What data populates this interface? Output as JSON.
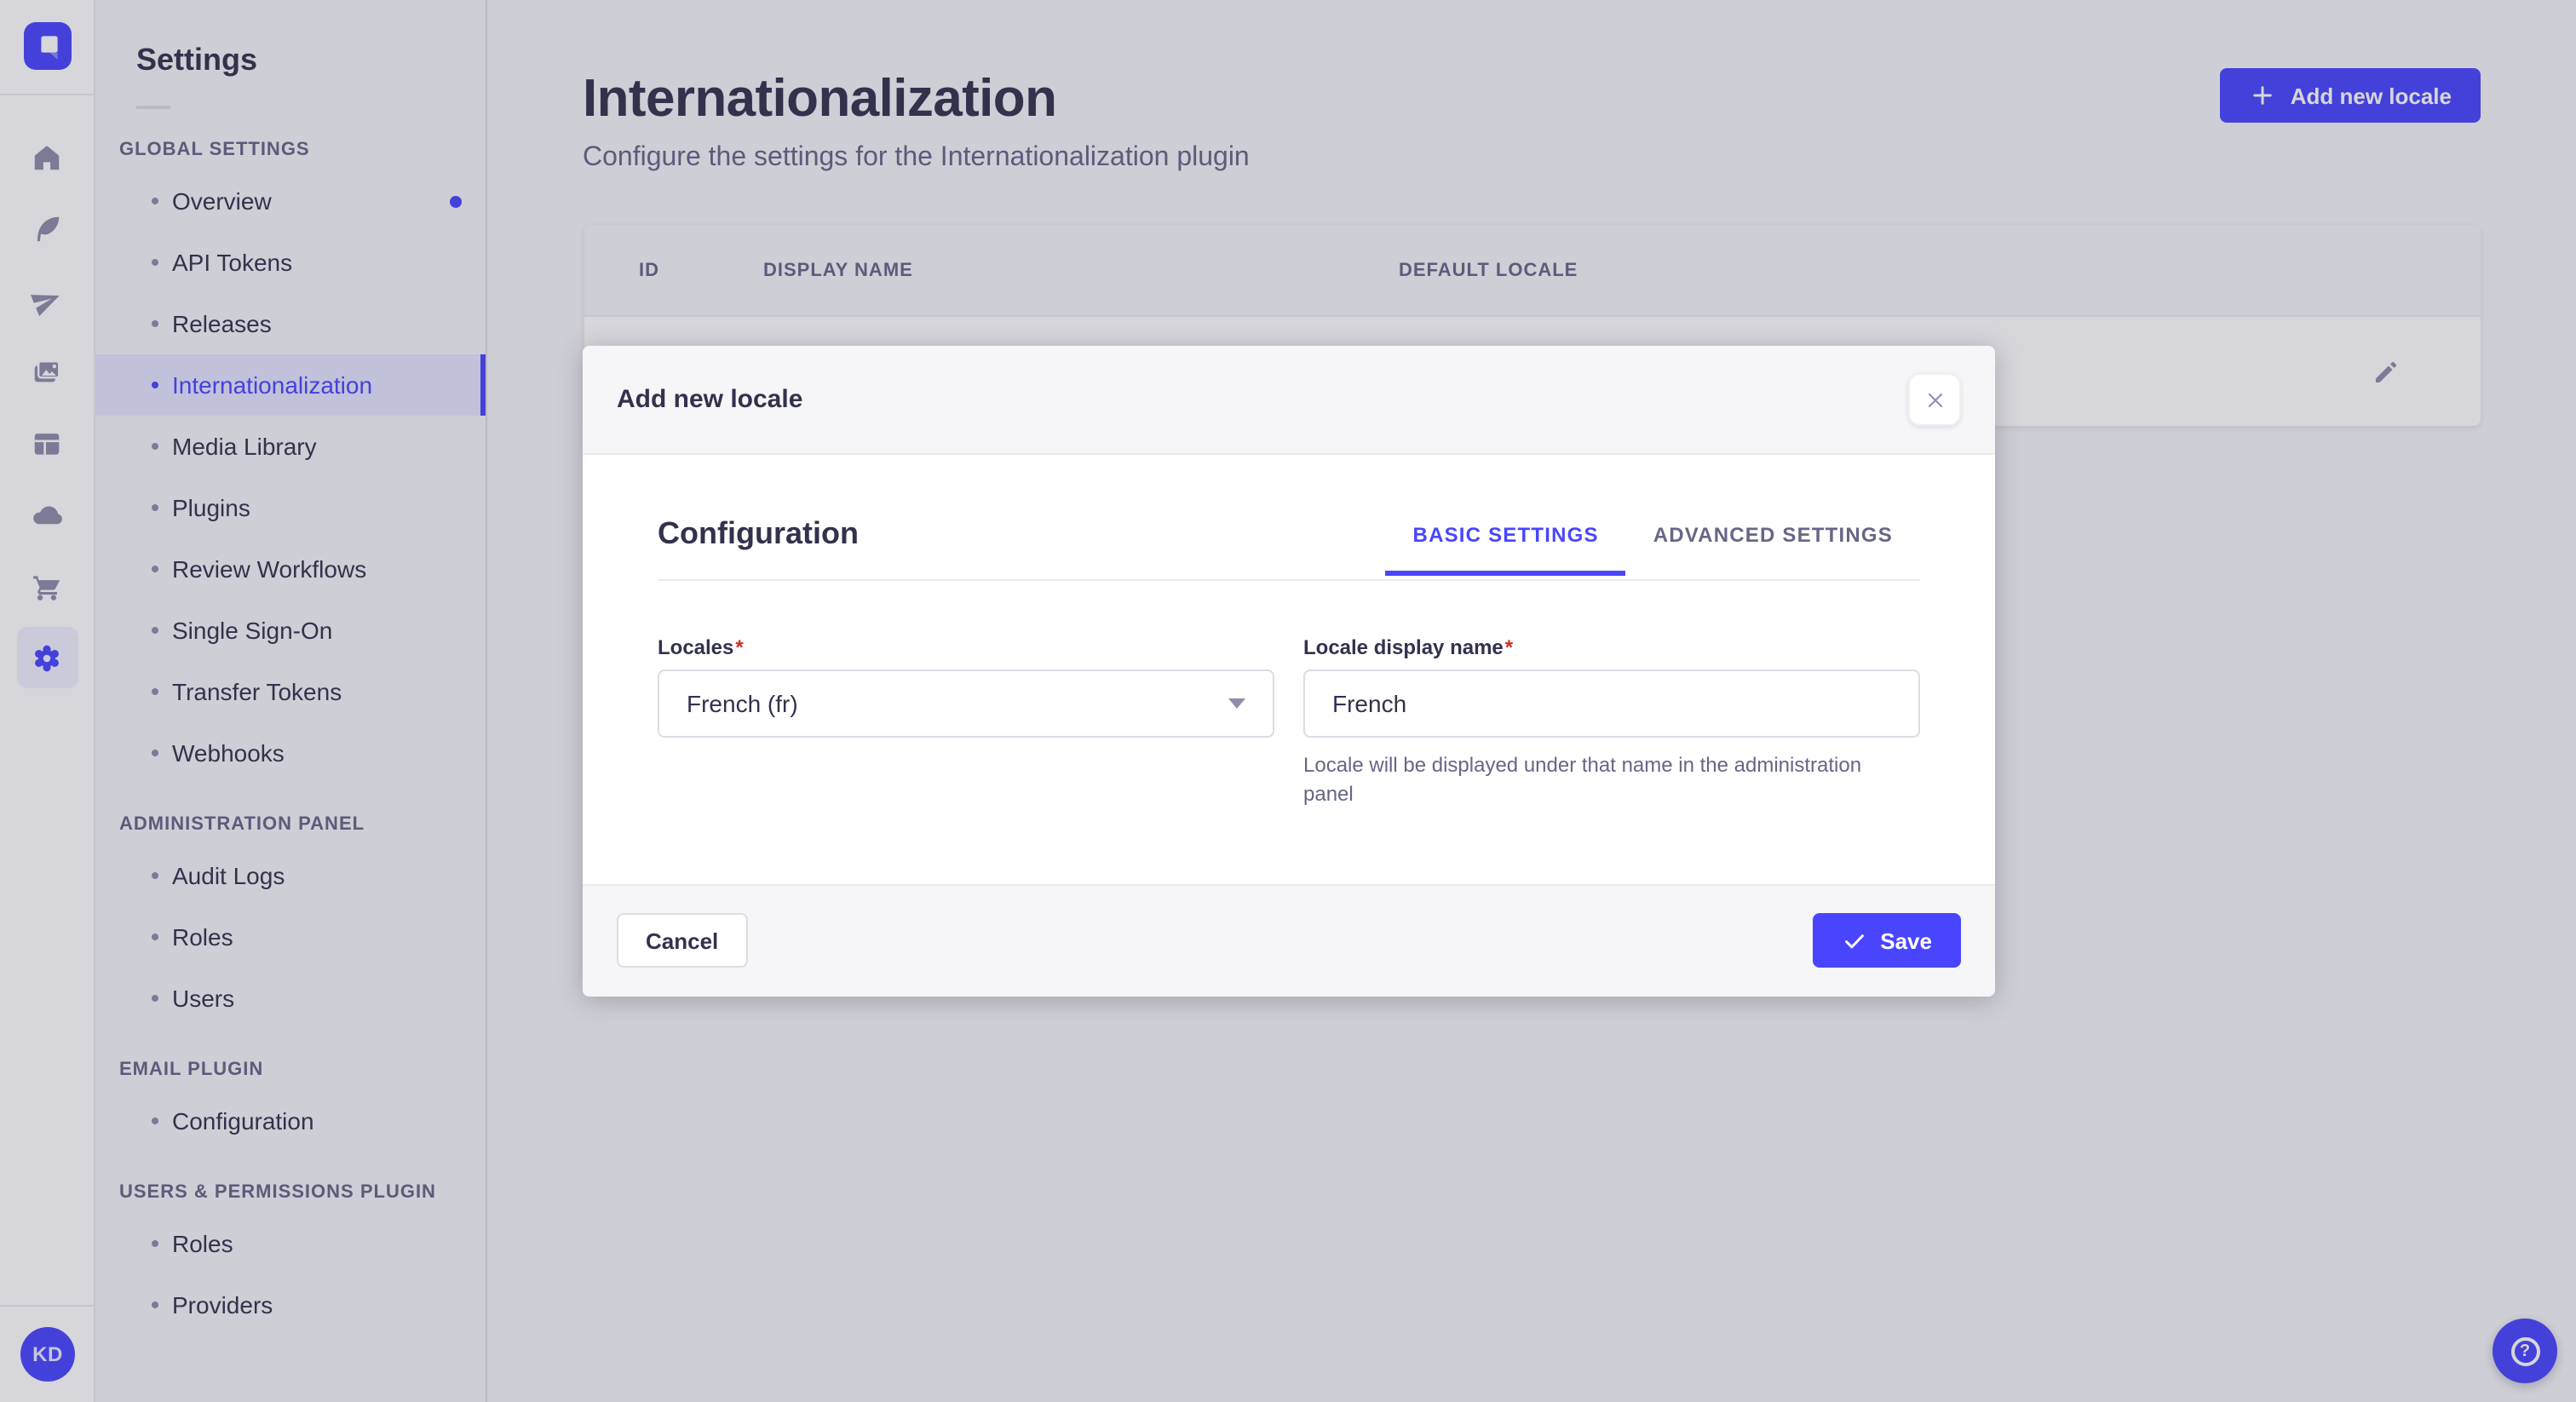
{
  "colors": {
    "primary": "#4945ff",
    "primary-bg": "#e6e5ff",
    "primary-soft": "#f0f0ff",
    "text": "#32324d",
    "text-muted": "#666687",
    "danger": "#d02b20"
  },
  "rail": {
    "avatar_initials": "KD",
    "help_glyph": "?"
  },
  "sidebar": {
    "title": "Settings",
    "sections": [
      {
        "label": "GLOBAL SETTINGS",
        "items": [
          {
            "label": "Overview"
          },
          {
            "label": "API Tokens"
          },
          {
            "label": "Releases"
          },
          {
            "label": "Internationalization"
          },
          {
            "label": "Media Library"
          },
          {
            "label": "Plugins"
          },
          {
            "label": "Review Workflows"
          },
          {
            "label": "Single Sign-On"
          },
          {
            "label": "Transfer Tokens"
          },
          {
            "label": "Webhooks"
          }
        ]
      },
      {
        "label": "ADMINISTRATION PANEL",
        "items": [
          {
            "label": "Audit Logs"
          },
          {
            "label": "Roles"
          },
          {
            "label": "Users"
          }
        ]
      },
      {
        "label": "EMAIL PLUGIN",
        "items": [
          {
            "label": "Configuration"
          }
        ]
      },
      {
        "label": "USERS & PERMISSIONS PLUGIN",
        "items": [
          {
            "label": "Roles"
          },
          {
            "label": "Providers"
          }
        ]
      }
    ]
  },
  "page": {
    "title": "Internationalization",
    "subtitle": "Configure the settings for the Internationalization plugin",
    "add_button_label": "Add new locale",
    "table": {
      "columns": [
        "ID",
        "DISPLAY NAME",
        "DEFAULT LOCALE"
      ]
    }
  },
  "modal": {
    "title": "Add new locale",
    "section_title": "Configuration",
    "tabs": [
      {
        "label": "BASIC SETTINGS"
      },
      {
        "label": "ADVANCED SETTINGS"
      }
    ],
    "fields": {
      "locales": {
        "label": "Locales",
        "required_mark": "*",
        "value": "French (fr)"
      },
      "display_name": {
        "label": "Locale display name",
        "required_mark": "*",
        "value": "French",
        "help": "Locale will be displayed under that name in the administration panel"
      }
    },
    "cancel_label": "Cancel",
    "save_label": "Save"
  }
}
